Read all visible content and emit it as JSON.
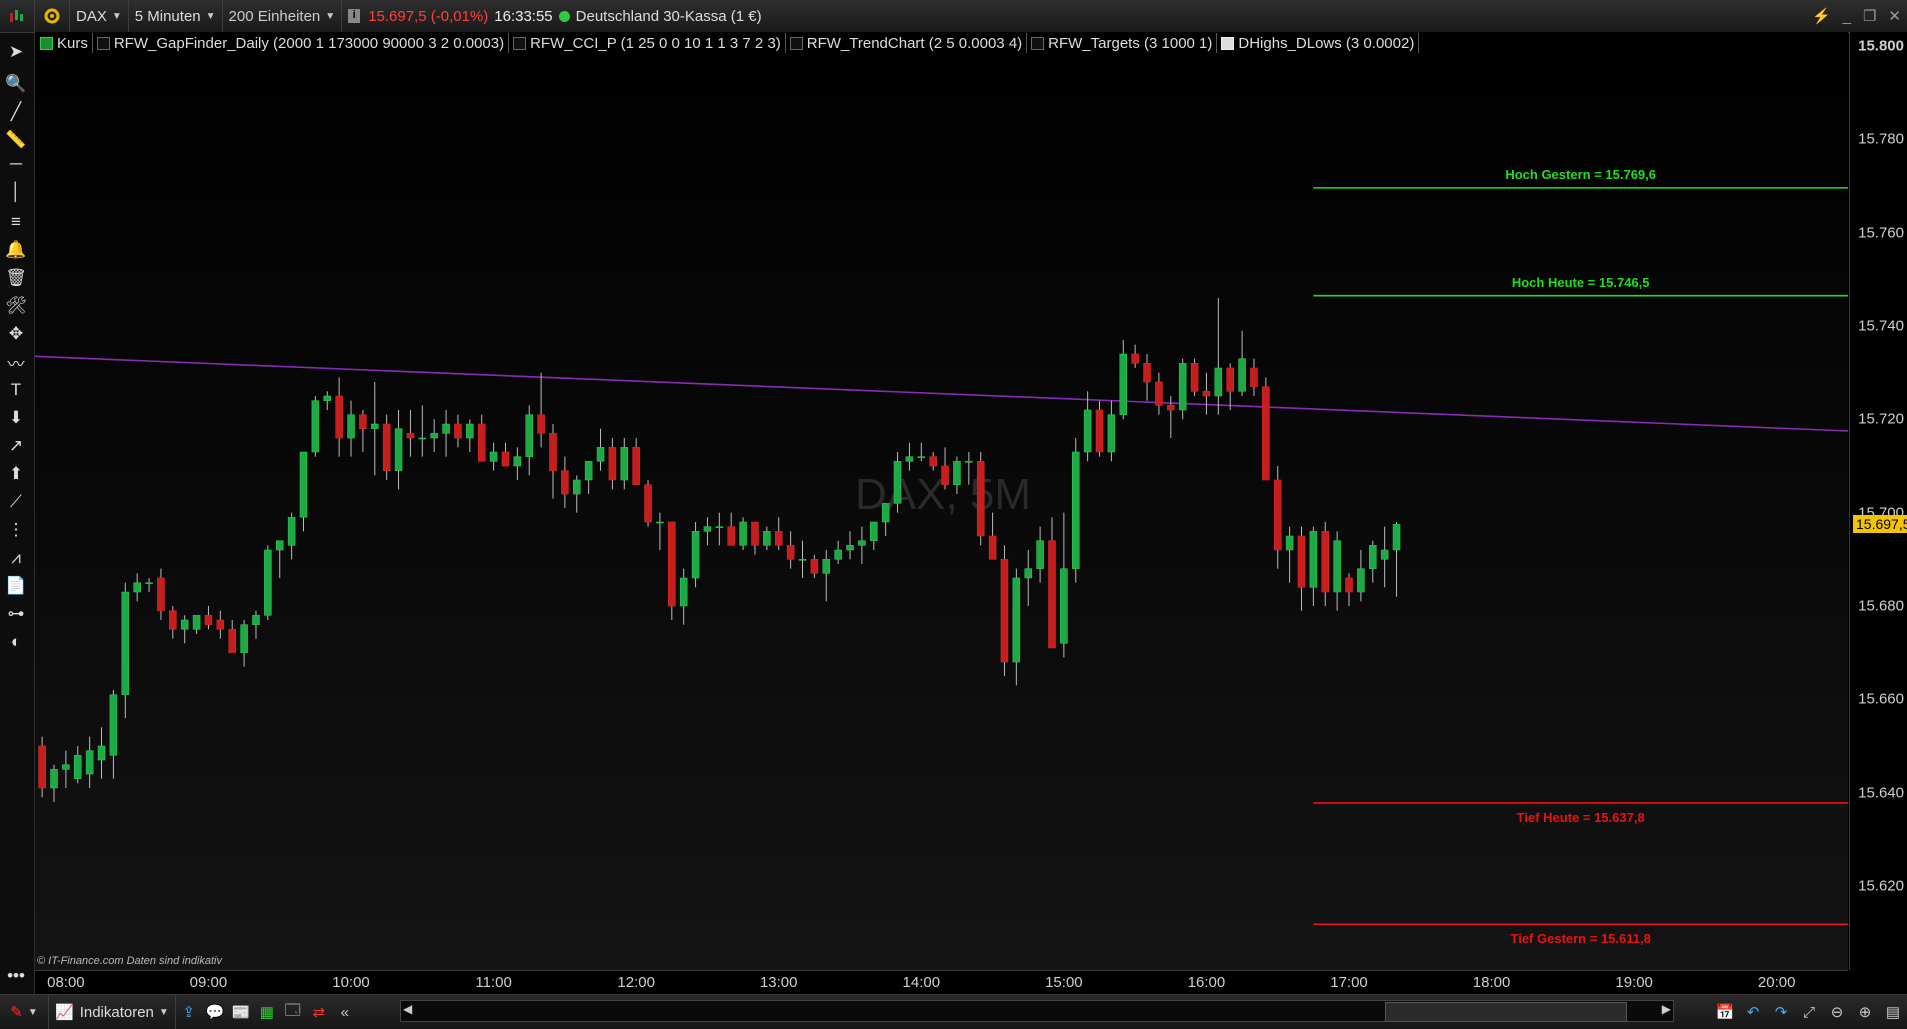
{
  "toolbar": {
    "symbol": "DAX",
    "interval": "5 Minuten",
    "units": "200 Einheiten",
    "price": "15.697,5 (-0,01%)",
    "time": "16:33:55",
    "instrument": "Deutschland 30-Kassa (1 €)",
    "price_color": "#ff4040",
    "status_color": "#2ecc40"
  },
  "legend": [
    {
      "label": "Kurs",
      "box": "g"
    },
    {
      "label": "RFW_GapFinder_Daily (2000 1 173000 90000 3 2 0.0003)",
      "box": ""
    },
    {
      "label": "RFW_CCI_P (1 25 0 0 10 1 1 3 7 2 3)",
      "box": ""
    },
    {
      "label": "RFW_TrendChart (2 5 0.0003 4)",
      "box": ""
    },
    {
      "label": "RFW_Targets (3 1000 1)",
      "box": ""
    },
    {
      "label": "DHighs_DLows (3 0.0002)",
      "box": "w"
    }
  ],
  "watermark": "DAX, 5M",
  "credit": "© IT-Finance.com  Daten sind indikativ",
  "bottom": {
    "indicators_label": "Indikatoren"
  },
  "chart_data": {
    "type": "candlestick",
    "y_range": [
      15602,
      15803
    ],
    "x_range": [
      "07:47",
      "20:30"
    ],
    "y_ticks": [
      "15.800",
      "15.780",
      "15.760",
      "15.740",
      "15.720",
      "15.700",
      "15.680",
      "15.660",
      "15.640",
      "15.620"
    ],
    "x_ticks": [
      "08:00",
      "09:00",
      "10:00",
      "11:00",
      "12:00",
      "13:00",
      "14:00",
      "15:00",
      "16:00",
      "17:00",
      "18:00",
      "19:00",
      "20:00"
    ],
    "last_price": "15.697,5",
    "levels": [
      {
        "label": "Hoch Gestern = 15.769,6",
        "value": 15769.6,
        "color": "#22dd22"
      },
      {
        "label": "Hoch Heute = 15.746,5",
        "value": 15746.5,
        "color": "#22dd22"
      },
      {
        "label": "Tief Heute = 15.637,8",
        "value": 15637.8,
        "color": "#ee1111"
      },
      {
        "label": "Tief Gestern = 15.611,8",
        "value": 15611.8,
        "color": "#ee1111"
      }
    ],
    "trendline": {
      "from": [
        "07:47",
        15733.5
      ],
      "to": [
        "20:30",
        15717.5
      ],
      "color": "#8a2bb8"
    },
    "up_color": "#1fa846",
    "down_color": "#c81d1d",
    "candles": [
      [
        "07:50",
        15650,
        15652,
        15639,
        15641
      ],
      [
        "07:55",
        15641,
        15646,
        15638,
        15645
      ],
      [
        "08:00",
        15645,
        15649,
        15641,
        15646
      ],
      [
        "08:05",
        15643,
        15650,
        15642,
        15648
      ],
      [
        "08:10",
        15644,
        15652,
        15641,
        15649
      ],
      [
        "08:15",
        15647,
        15654,
        15643,
        15650
      ],
      [
        "08:20",
        15648,
        15662,
        15643,
        15661
      ],
      [
        "08:25",
        15661,
        15685,
        15656,
        15683
      ],
      [
        "08:30",
        15683,
        15687,
        15681,
        15685
      ],
      [
        "08:35",
        15685,
        15686,
        15683,
        15685
      ],
      [
        "08:40",
        15686,
        15688,
        15677,
        15679
      ],
      [
        "08:45",
        15679,
        15680,
        15673,
        15675
      ],
      [
        "08:50",
        15675,
        15678,
        15672,
        15677
      ],
      [
        "08:55",
        15675,
        15678,
        15674,
        15678
      ],
      [
        "09:00",
        15678,
        15680,
        15675,
        15676
      ],
      [
        "09:05",
        15677,
        15679,
        15673,
        15675
      ],
      [
        "09:10",
        15675,
        15677,
        15670,
        15670
      ],
      [
        "09:15",
        15670,
        15677,
        15667,
        15676
      ],
      [
        "09:20",
        15676,
        15679,
        15673,
        15678
      ],
      [
        "09:25",
        15678,
        15693,
        15677,
        15692
      ],
      [
        "09:30",
        15692,
        15694,
        15686,
        15694
      ],
      [
        "09:35",
        15693,
        15700,
        15690,
        15699
      ],
      [
        "09:40",
        15699,
        15713,
        15696,
        15713
      ],
      [
        "09:45",
        15713,
        15725,
        15712,
        15724
      ],
      [
        "09:50",
        15724,
        15726,
        15722,
        15725
      ],
      [
        "09:55",
        15725,
        15729,
        15712,
        15716
      ],
      [
        "10:00",
        15716,
        15724,
        15712,
        15721
      ],
      [
        "10:05",
        15721,
        15722,
        15713,
        15718
      ],
      [
        "10:10",
        15718,
        15728,
        15708,
        15719
      ],
      [
        "10:15",
        15719,
        15721,
        15707,
        15709
      ],
      [
        "10:20",
        15709,
        15722,
        15705,
        15718
      ],
      [
        "10:25",
        15717,
        15722,
        15712,
        15716
      ],
      [
        "10:30",
        15716,
        15723,
        15712,
        15716
      ],
      [
        "10:35",
        15716,
        15720,
        15713,
        15717
      ],
      [
        "10:40",
        15717,
        15722,
        15712,
        15719
      ],
      [
        "10:45",
        15719,
        15721,
        15714,
        15716
      ],
      [
        "10:50",
        15716,
        15720,
        15713,
        15719
      ],
      [
        "10:55",
        15719,
        15721,
        15711,
        15711
      ],
      [
        "11:00",
        15711,
        15715,
        15709,
        15713
      ],
      [
        "11:05",
        15713,
        15715,
        15710,
        15710
      ],
      [
        "11:10",
        15710,
        15714,
        15707,
        15712
      ],
      [
        "11:15",
        15712,
        15723,
        15708,
        15721
      ],
      [
        "11:20",
        15721,
        15730,
        15714,
        15717
      ],
      [
        "11:25",
        15717,
        15719,
        15703,
        15709
      ],
      [
        "11:30",
        15709,
        15712,
        15701,
        15704
      ],
      [
        "11:35",
        15704,
        15708,
        15700,
        15707
      ],
      [
        "11:40",
        15707,
        15711,
        15704,
        15711
      ],
      [
        "11:45",
        15711,
        15718,
        15709,
        15714
      ],
      [
        "11:50",
        15714,
        15716,
        15705,
        15707
      ],
      [
        "11:55",
        15707,
        15716,
        15705,
        15714
      ],
      [
        "12:00",
        15714,
        15716,
        15706,
        15706
      ],
      [
        "12:05",
        15706,
        15707,
        15697,
        15698
      ],
      [
        "12:10",
        15698,
        15700,
        15692,
        15698
      ],
      [
        "12:15",
        15698,
        15698,
        15677,
        15680
      ],
      [
        "12:20",
        15680,
        15688,
        15676,
        15686
      ],
      [
        "12:25",
        15686,
        15698,
        15684,
        15696
      ],
      [
        "12:30",
        15696,
        15699,
        15693,
        15697
      ],
      [
        "12:35",
        15697,
        15700,
        15693,
        15697
      ],
      [
        "12:40",
        15697,
        15700,
        15694,
        15693
      ],
      [
        "12:45",
        15693,
        15699,
        15692,
        15698
      ],
      [
        "12:50",
        15698,
        15698,
        15691,
        15693
      ],
      [
        "12:55",
        15693,
        15697,
        15692,
        15696
      ],
      [
        "13:00",
        15696,
        15699,
        15692,
        15693
      ],
      [
        "13:05",
        15693,
        15696,
        15688,
        15690
      ],
      [
        "13:10",
        15690,
        15694,
        15686,
        15690
      ],
      [
        "13:15",
        15690,
        15691,
        15686,
        15687
      ],
      [
        "13:20",
        15687,
        15692,
        15681,
        15690
      ],
      [
        "13:25",
        15690,
        15694,
        15689,
        15692
      ],
      [
        "13:30",
        15692,
        15696,
        15690,
        15693
      ],
      [
        "13:35",
        15693,
        15697,
        15689,
        15694
      ],
      [
        "13:40",
        15694,
        15698,
        15692,
        15698
      ],
      [
        "13:45",
        15698,
        15702,
        15695,
        15702
      ],
      [
        "13:50",
        15702,
        15713,
        15700,
        15711
      ],
      [
        "13:55",
        15711,
        15715,
        15709,
        15712
      ],
      [
        "14:00",
        15712,
        15715,
        15711,
        15712
      ],
      [
        "14:05",
        15712,
        15713,
        15709,
        15710
      ],
      [
        "14:10",
        15710,
        15714,
        15705,
        15706
      ],
      [
        "14:15",
        15706,
        15712,
        15704,
        15711
      ],
      [
        "14:20",
        15711,
        15713,
        15706,
        15711
      ],
      [
        "14:25",
        15711,
        15713,
        15693,
        15695
      ],
      [
        "14:30",
        15695,
        15700,
        15690,
        15690
      ],
      [
        "14:35",
        15690,
        15693,
        15665,
        15668
      ],
      [
        "14:40",
        15668,
        15688,
        15663,
        15686
      ],
      [
        "14:45",
        15686,
        15692,
        15680,
        15688
      ],
      [
        "14:50",
        15688,
        15697,
        15685,
        15694
      ],
      [
        "14:55",
        15694,
        15699,
        15675,
        15671
      ],
      [
        "15:00",
        15672,
        15700,
        15669,
        15688
      ],
      [
        "15:05",
        15688,
        15716,
        15685,
        15713
      ],
      [
        "15:10",
        15713,
        15726,
        15711,
        15722
      ],
      [
        "15:15",
        15722,
        15724,
        15712,
        15713
      ],
      [
        "15:20",
        15713,
        15724,
        15711,
        15721
      ],
      [
        "15:25",
        15721,
        15737,
        15720,
        15734
      ],
      [
        "15:30",
        15734,
        15736,
        15731,
        15732
      ],
      [
        "15:35",
        15732,
        15734,
        15724,
        15728
      ],
      [
        "15:40",
        15728,
        15730,
        15721,
        15723
      ],
      [
        "15:45",
        15723,
        15725,
        15716,
        15722
      ],
      [
        "15:50",
        15722,
        15733,
        15720,
        15732
      ],
      [
        "15:55",
        15732,
        15733,
        15725,
        15726
      ],
      [
        "16:00",
        15726,
        15730,
        15721,
        15725
      ],
      [
        "16:05",
        15725,
        15746,
        15721,
        15731
      ],
      [
        "16:10",
        15731,
        15732,
        15722,
        15726
      ],
      [
        "16:15",
        15726,
        15739,
        15725,
        15733
      ],
      [
        "16:20",
        15731,
        15733,
        15725,
        15727
      ],
      [
        "16:25",
        15727,
        15729,
        15707,
        15707
      ],
      [
        "16:30",
        15707,
        15710,
        15688,
        15692
      ],
      [
        "16:35",
        15692,
        15697,
        15685,
        15695
      ],
      [
        "16:40",
        15695,
        15697,
        15679,
        15684
      ],
      [
        "16:45",
        15684,
        15697,
        15680,
        15696
      ],
      [
        "16:50",
        15696,
        15698,
        15680,
        15683
      ],
      [
        "16:55",
        15683,
        15696,
        15679,
        15694
      ],
      [
        "17:00",
        15686,
        15687,
        15680,
        15683
      ],
      [
        "17:05",
        15683,
        15692,
        15681,
        15688
      ],
      [
        "17:10",
        15688,
        15694,
        15685,
        15693
      ],
      [
        "17:15",
        15690,
        15697,
        15684,
        15692
      ],
      [
        "17:20",
        15692,
        15698,
        15682,
        15697.5
      ]
    ]
  }
}
